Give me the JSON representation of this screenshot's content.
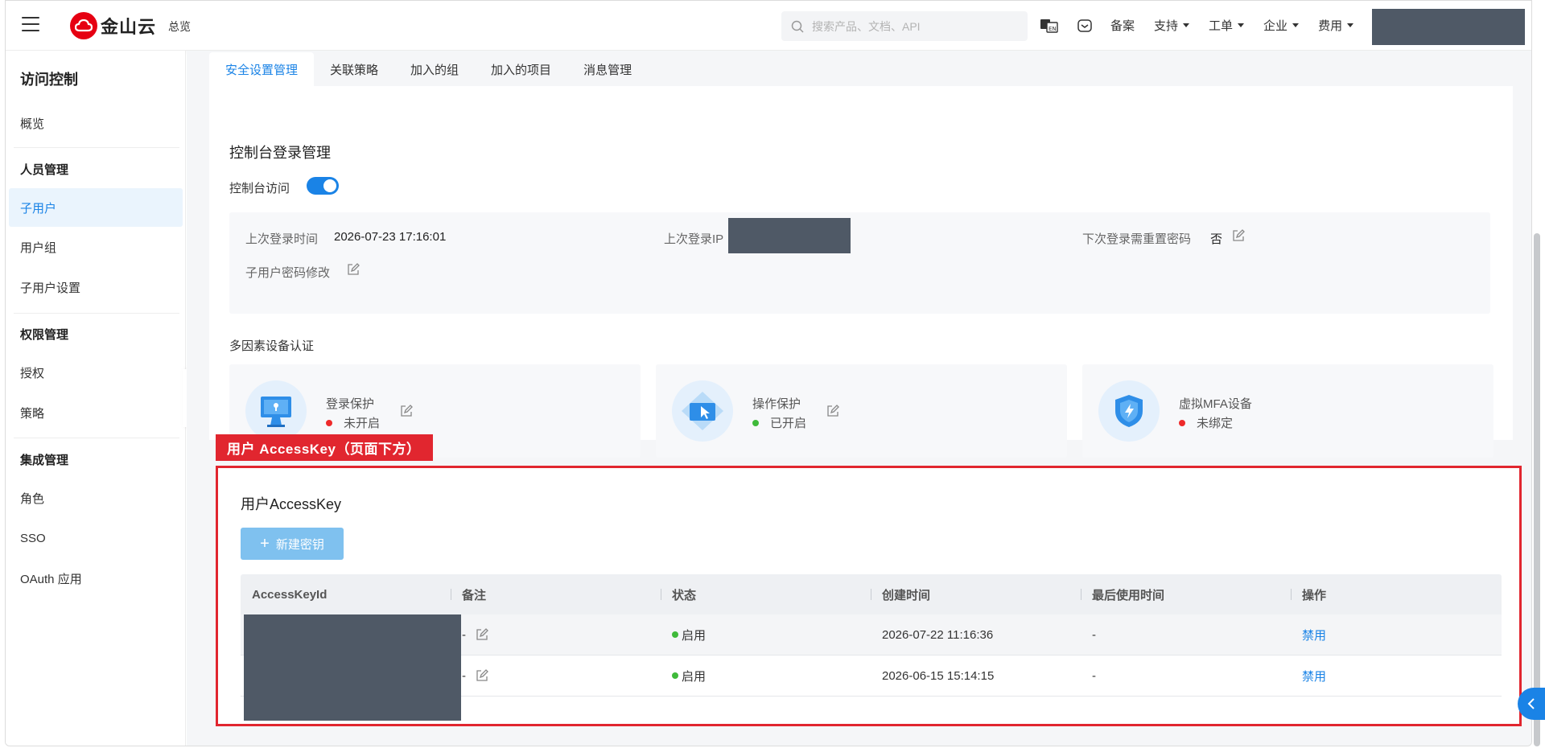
{
  "header": {
    "logo_text": "金山云",
    "overview": "总览",
    "search_placeholder": "搜索产品、文档、API",
    "nav": [
      {
        "label": "备案"
      },
      {
        "label": "支持"
      },
      {
        "label": "工单"
      },
      {
        "label": "企业"
      },
      {
        "label": "费用"
      }
    ]
  },
  "sidebar": {
    "title": "访问控制",
    "overview": "概览",
    "groups": {
      "people": "人员管理",
      "permission": "权限管理",
      "integration": "集成管理"
    },
    "items": {
      "subuser": "子用户",
      "usergroup": "用户组",
      "subuser_settings": "子用户设置",
      "authorize": "授权",
      "policy": "策略",
      "role": "角色",
      "sso": "SSO",
      "oauth": "OAuth 应用"
    }
  },
  "tabs": [
    "安全设置管理",
    "关联策略",
    "加入的组",
    "加入的项目",
    "消息管理"
  ],
  "console_login": {
    "title": "控制台登录管理",
    "toggle_label": "控制台访问",
    "toggle_on": true,
    "last_login_label": "上次登录时间",
    "last_login_value": "2026-07-23 17:16:01",
    "last_ip_label": "上次登录IP",
    "reset_pwd_label": "下次登录需重置密码",
    "reset_pwd_value": "否",
    "pwd_change_label": "子用户密码修改"
  },
  "mfa": {
    "title": "多因素设备认证",
    "cards": [
      {
        "name": "登录保护",
        "status": "未开启",
        "status_color": "#ee2a2a"
      },
      {
        "name": "操作保护",
        "status": "已开启",
        "status_color": "#3fba3a"
      },
      {
        "name": "虚拟MFA设备",
        "status": "未绑定",
        "status_color": "#ee2a2a"
      }
    ]
  },
  "annotation": {
    "label": "用户 AccessKey（页面下方）"
  },
  "accesskey": {
    "title": "用户AccessKey",
    "new_button": "新建密钥",
    "columns": [
      "AccessKeyId",
      "备注",
      "状态",
      "创建时间",
      "最后使用时间",
      "操作"
    ],
    "rows": [
      {
        "remark": "-",
        "status": "启用",
        "created": "2026-07-22 11:16:36",
        "last_used": "-",
        "action": "禁用"
      },
      {
        "remark": "-",
        "status": "启用",
        "created": "2026-06-15 15:14:15",
        "last_used": "-",
        "action": "禁用"
      }
    ]
  },
  "colors": {
    "accent": "#1a83e6",
    "brand_red": "#e60012",
    "annotation_red": "#e1262f",
    "mask": "#4f5966"
  }
}
